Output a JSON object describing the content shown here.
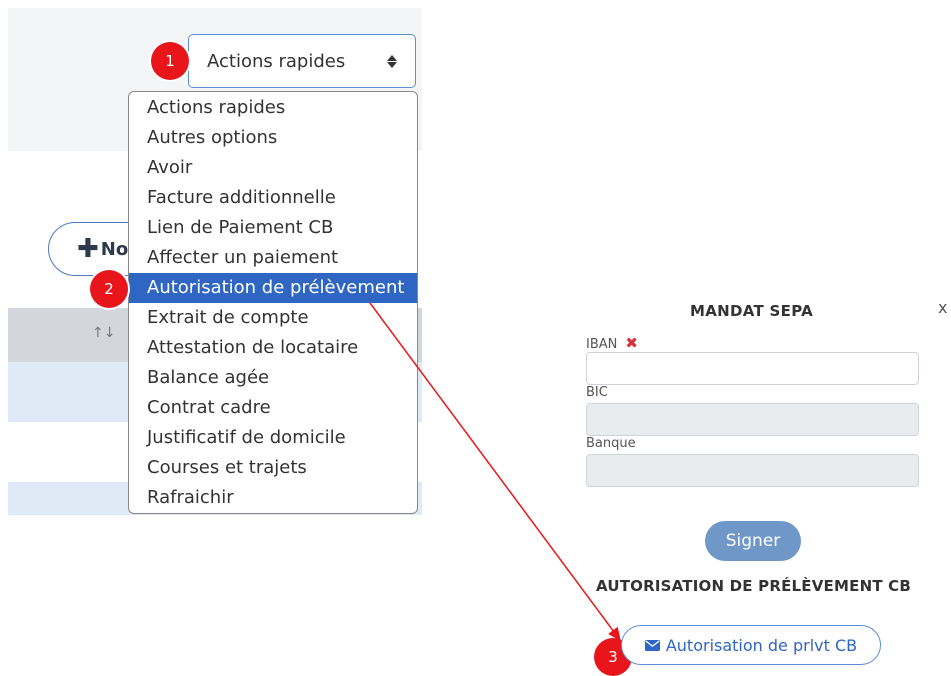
{
  "select": {
    "value": "Actions rapides"
  },
  "new_button": {
    "label": "No"
  },
  "dropdown": {
    "options": [
      "Actions rapides",
      "Autres options",
      "Avoir",
      "Facture additionnelle",
      "Lien de Paiement CB",
      "Affecter un paiement",
      "Autorisation de prélèvement",
      "Extrait de compte",
      "Attestation de locataire",
      "Balance agée",
      "Contrat cadre",
      "Justificatif de domicile",
      "Courses et trajets",
      "Rafraichir"
    ],
    "selected_index": 6
  },
  "table": {
    "sort_icon": "↑↓"
  },
  "markers": [
    "1",
    "2",
    "3"
  ],
  "modal": {
    "close": "x",
    "title": "MANDAT SEPA",
    "fields": {
      "iban": {
        "label": "IBAN",
        "required_mark": "✖",
        "value": ""
      },
      "bic": {
        "label": "BIC",
        "value": ""
      },
      "banque": {
        "label": "Banque",
        "value": ""
      }
    },
    "sign_button": "Signer",
    "section_title": "AUTORISATION DE PRÉLÈVEMENT CB",
    "autorisation_button": "Autorisation de prlvt CB"
  },
  "colors": {
    "marker_red": "#e8161b",
    "selected_blue": "#2f66c4",
    "arrow_red": "#e8161b"
  },
  "icons": {
    "plus": "plus-icon",
    "select_arrows": "sort-arrows-icon",
    "envelope": "envelope-icon"
  }
}
